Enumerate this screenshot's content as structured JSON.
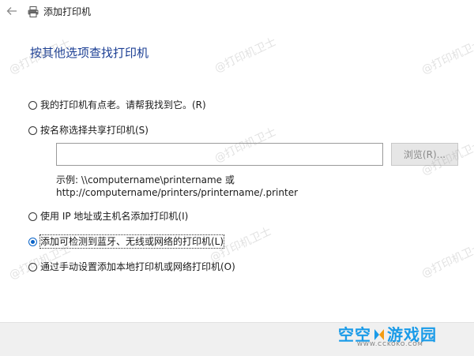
{
  "window": {
    "title": "添加打印机"
  },
  "heading": "按其他选项查找打印机",
  "options": [
    {
      "label": "我的打印机有点老。请帮我找到它。(R)",
      "checked": false
    },
    {
      "label": "按名称选择共享打印机(S)",
      "checked": false
    },
    {
      "label": "使用 IP 地址或主机名添加打印机(I)",
      "checked": false
    },
    {
      "label": "添加可检测到蓝牙、无线或网络的打印机(L)",
      "checked": true
    },
    {
      "label": "通过手动设置添加本地打印机或网络打印机(O)",
      "checked": false
    }
  ],
  "shared": {
    "input_value": "",
    "browse_label": "浏览(R)...",
    "example_line1": "示例: \\\\computername\\printername 或",
    "example_line2": "http://computername/printers/printername/.printer"
  },
  "watermark": "@打印机卫士",
  "logo": {
    "text_left": "空空",
    "text_right": "游戏园",
    "sub": "WWW.CCKOKO.COM"
  },
  "colors": {
    "heading": "#1c3f94",
    "radio_checked": "#0a64c8",
    "logo": "#1a9be8"
  }
}
